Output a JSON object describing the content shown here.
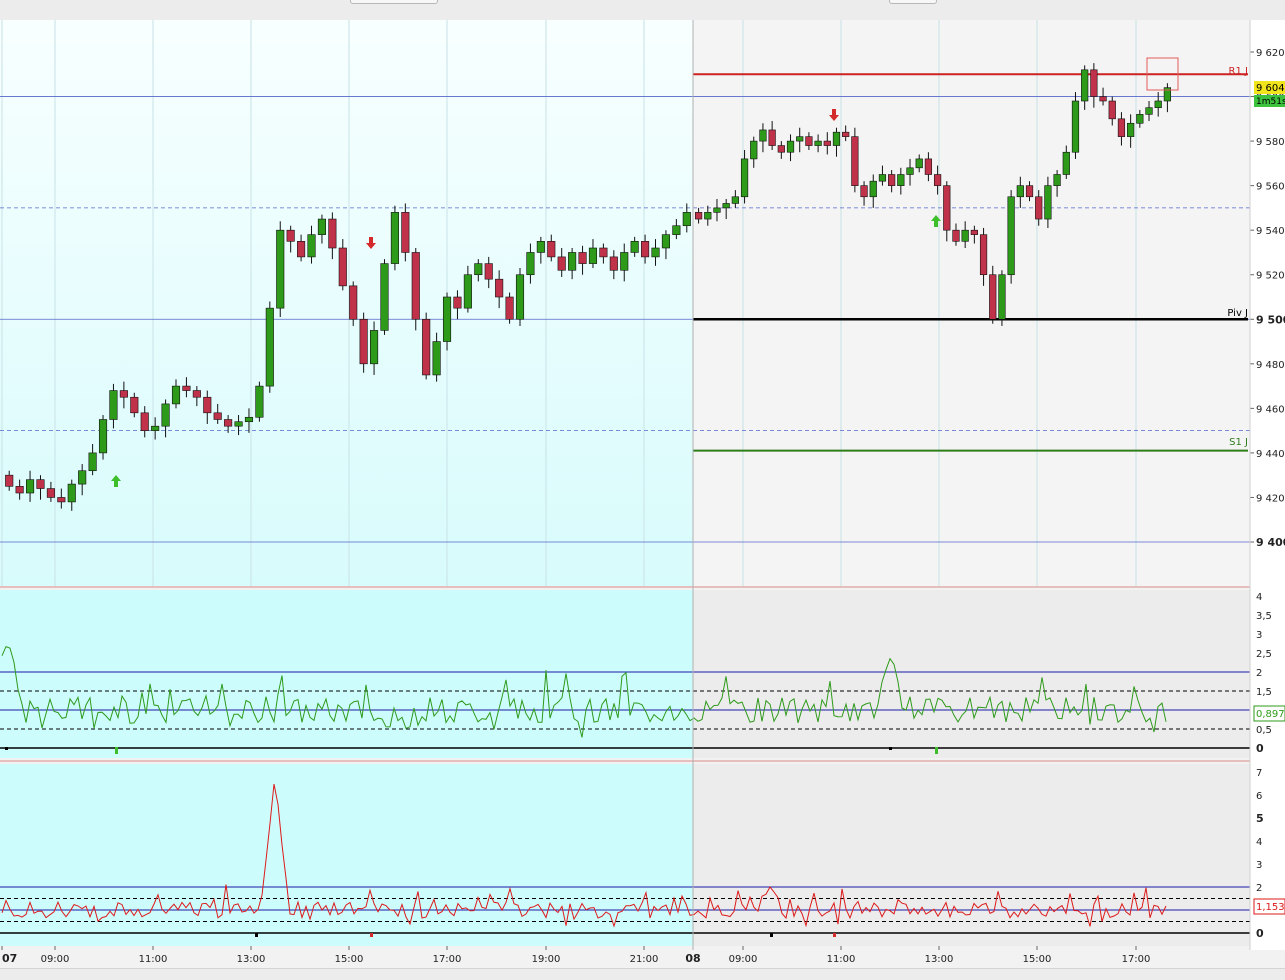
{
  "chart_data": [
    {
      "type": "candlestick",
      "panel": "price",
      "ylim": [
        9390,
        9630
      ],
      "y_ticks": [
        "9 620",
        "9 600",
        "9 580",
        "9 560",
        "9 540",
        "9 520",
        "9 500",
        "9 480",
        "9 460",
        "9 440",
        "9 420",
        "9 400"
      ],
      "y_ticks_bold": [
        "9 500",
        "9 400"
      ],
      "session_boundary_time": "08",
      "horizontal_lines": [
        {
          "label": "R1 J",
          "value": 9610,
          "color": "#cc2222"
        },
        {
          "label": "Piv J",
          "value": 9500,
          "color": "#000000"
        },
        {
          "label": "S1 J",
          "value": 9441,
          "color": "#2e7d1a"
        }
      ],
      "last_price_label": "9 604,",
      "countdown_label": "1m51s",
      "candles_per_day_1": [
        9425,
        9422,
        9428,
        9424,
        9420,
        9418,
        9426,
        9432,
        9440,
        9455,
        9468,
        9465,
        9458,
        9450,
        9452,
        9462,
        9470,
        9468,
        9465,
        9458,
        9455,
        9452,
        9454,
        9456,
        9470,
        9505,
        9540,
        9535,
        9528,
        9538,
        9545,
        9532,
        9515,
        9500,
        9480,
        9495,
        9525,
        9548,
        9530,
        9500,
        9475,
        9490,
        9510,
        9505,
        9520,
        9525,
        9518,
        9510,
        9500,
        9520,
        9530,
        9535,
        9528,
        9522,
        9530,
        9525,
        9532,
        9528,
        9522,
        9530,
        9535,
        9528,
        9532,
        9538,
        9542,
        9548
      ],
      "candles_per_day_2": [
        9545,
        9548,
        9550,
        9552,
        9555,
        9572,
        9580,
        9585,
        9578,
        9575,
        9580,
        9582,
        9578,
        9580,
        9578,
        9584,
        9582,
        9560,
        9555,
        9562,
        9565,
        9560,
        9565,
        9568,
        9572,
        9565,
        9560,
        9540,
        9535,
        9540,
        9538,
        9520,
        9500,
        9520,
        9555,
        9560,
        9555,
        9545,
        9560,
        9565,
        9575,
        9598,
        9612,
        9600,
        9598,
        9590,
        9582,
        9588,
        9592,
        9595,
        9598,
        9604
      ]
    },
    {
      "type": "line",
      "panel": "indicator-1",
      "series_color": "#2e9a1a",
      "ylim": [
        0,
        4
      ],
      "y_ticks": [
        "4",
        "3,5",
        "3",
        "2,5",
        "2",
        "1,5",
        "1",
        "0,5",
        "0"
      ],
      "y_ticks_bold": [
        "0"
      ],
      "reference_lines": [
        {
          "value": 2,
          "style": "solid",
          "color": "#1a1aa6"
        },
        {
          "value": 1.5,
          "style": "dashed",
          "color": "#000000"
        },
        {
          "value": 1,
          "style": "solid",
          "color": "#1a1aa6"
        },
        {
          "value": 0.5,
          "style": "dashed",
          "color": "#000000"
        }
      ],
      "last_value_label": "0,897",
      "highlights": [
        {
          "time": "07",
          "value": 2.9
        },
        {
          "time": "12:00",
          "value": 2.35
        },
        {
          "time": "14:00",
          "value": 0.45
        }
      ]
    },
    {
      "type": "line",
      "panel": "indicator-2",
      "series_color": "#dd1a1a",
      "ylim": [
        0,
        7
      ],
      "y_ticks": [
        "7",
        "6",
        "5",
        "4",
        "3",
        "2",
        "1",
        "0"
      ],
      "y_ticks_bold": [
        "5",
        "0"
      ],
      "reference_lines": [
        {
          "value": 2,
          "style": "solid",
          "color": "#1a1aa6"
        },
        {
          "value": 1.5,
          "style": "dashed",
          "color": "#000000"
        },
        {
          "value": 1,
          "style": "solid",
          "color": "#1a1aa6"
        },
        {
          "value": 0.5,
          "style": "dashed",
          "color": "#000000"
        }
      ],
      "last_value_label": "1,153",
      "highlights": [
        {
          "time": "13:00",
          "value": 6.9
        },
        {
          "time": "09:00",
          "value": 2.0
        }
      ]
    }
  ],
  "x_axis": {
    "ticks": [
      "07",
      "09:00",
      "11:00",
      "13:00",
      "15:00",
      "17:00",
      "19:00",
      "21:00",
      "08",
      "09:00",
      "11:00",
      "13:00",
      "15:00",
      "17:00"
    ],
    "bold_ticks": [
      "07",
      "08"
    ]
  },
  "colors": {
    "up_candle": "#2e9a1a",
    "down_candle": "#c0314a",
    "session1_bg": "#e8fcfd",
    "session2_bg": "#f2f2f2",
    "session1_indicator_bg": "#cdfcfd"
  }
}
